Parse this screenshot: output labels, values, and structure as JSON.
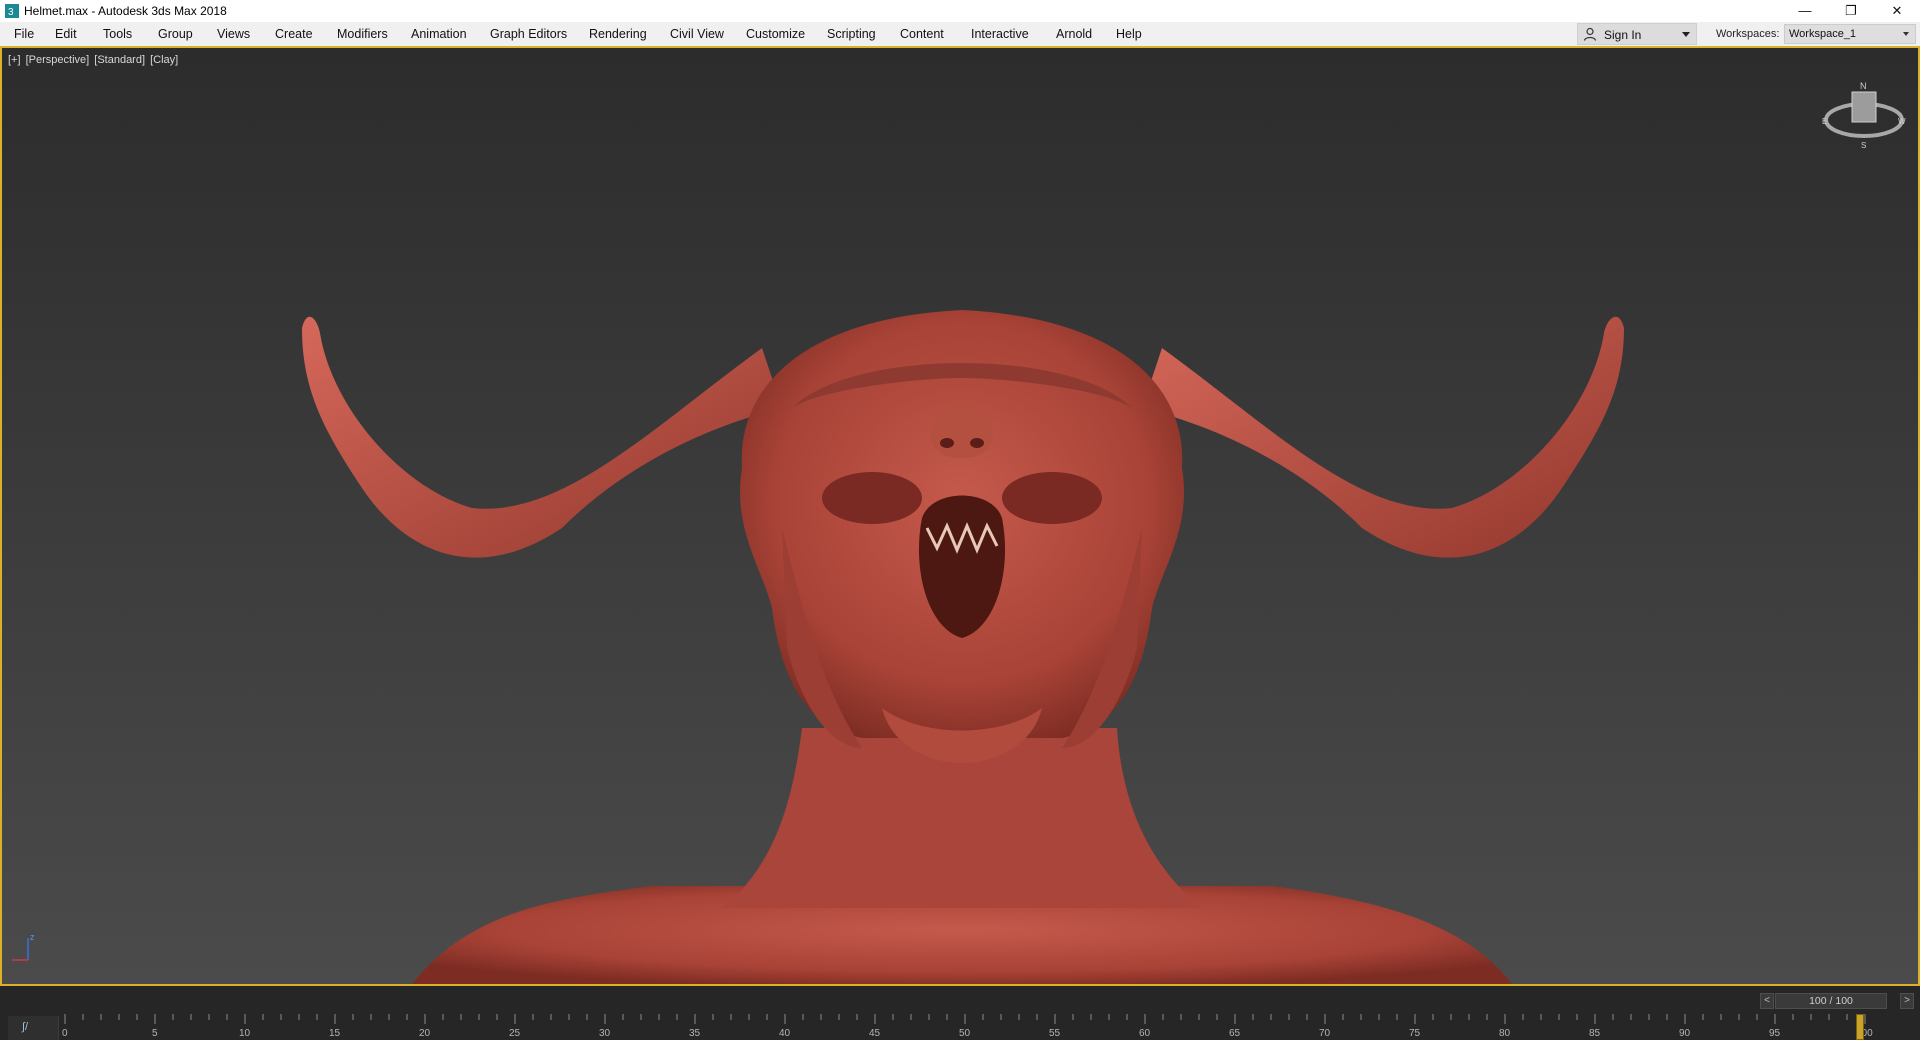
{
  "window": {
    "title": "Helmet.max - Autodesk 3ds Max 2018",
    "app_icon": "3ds-max-icon",
    "controls": [
      "minimize-icon",
      "restore-icon",
      "close-icon"
    ]
  },
  "menubar": {
    "items": [
      "File",
      "Edit",
      "Tools",
      "Group",
      "Views",
      "Create",
      "Modifiers",
      "Animation",
      "Graph Editors",
      "Rendering",
      "Civil View",
      "Customize",
      "Scripting",
      "Content",
      "Interactive",
      "Arnold",
      "Help"
    ],
    "sign_in": "Sign In",
    "workspaces_label": "Workspaces:",
    "workspace_value": "Workspace_1"
  },
  "viewport": {
    "label_plus": "[+]",
    "label_view": "[Perspective]",
    "label_shading": "[Standard]",
    "label_style": "[Clay]",
    "viewcube_icon": "viewcube-icon",
    "model_color": "#b64a3f",
    "axis_label": "z"
  },
  "timeline": {
    "frame_display": "100 / 100",
    "prev_arrow": "<",
    "next_arrow": ">",
    "track_toggle": "⌇⁄ ",
    "ticks": [
      "0",
      "5",
      "10",
      "15",
      "20",
      "25",
      "30",
      "35",
      "40",
      "45",
      "50",
      "55",
      "60",
      "65",
      "70",
      "75",
      "80",
      "85",
      "90",
      "95",
      "100"
    ],
    "current_frame": 100,
    "accent_color": "#d9b22a"
  }
}
